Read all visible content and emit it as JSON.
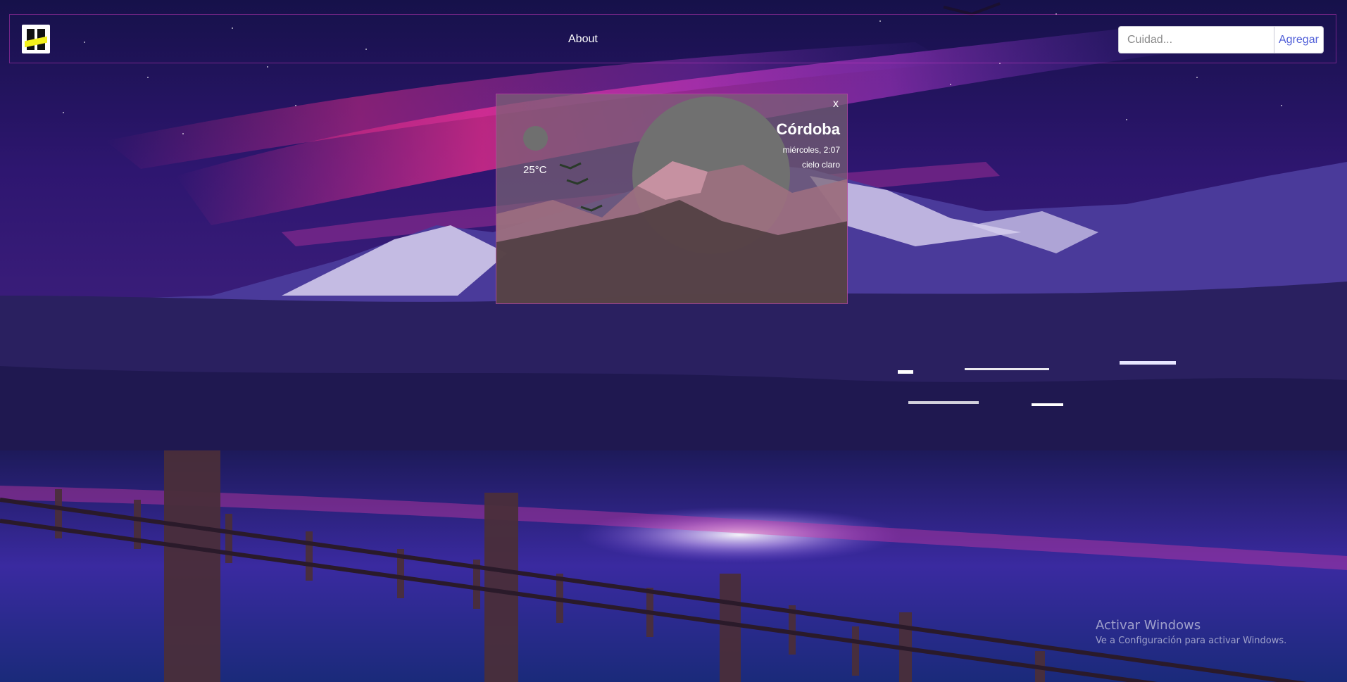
{
  "navbar": {
    "logo": "app-logo",
    "about_label": "About"
  },
  "search": {
    "placeholder": "Cuidad...",
    "value": "",
    "add_label": "Agregar"
  },
  "weather_card": {
    "close_label": "x",
    "city": "Córdoba",
    "datetime": "miércoles, 2:07",
    "description": "cielo claro",
    "temperature": "25°C",
    "icon": "weather-icon"
  },
  "watermark": {
    "title": "Activar Windows",
    "subtitle": "Ve a Configuración para activar Windows."
  },
  "colors": {
    "sky_top": "#1c1650",
    "sky_pink": "#e0308f",
    "mountain": "#c7bde6",
    "water": "#2a2a8a",
    "accent_link": "#4f5ed8"
  }
}
